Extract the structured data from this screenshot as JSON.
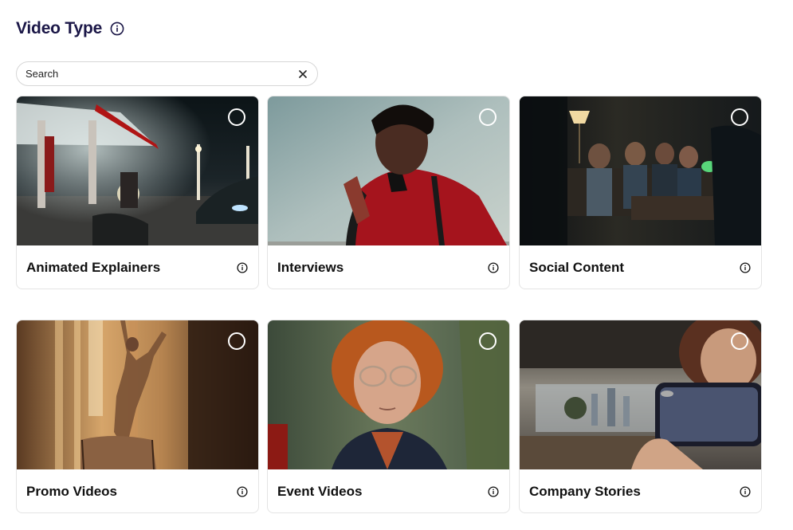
{
  "header": {
    "title": "Video Type",
    "info_icon": "info-icon"
  },
  "search": {
    "placeholder": "Search",
    "value": "",
    "clear_icon": "close-icon"
  },
  "cards": [
    {
      "label": "Animated Explainers",
      "selected": false,
      "image": "gas-station-night-motorcycle"
    },
    {
      "label": "Interviews",
      "selected": false,
      "image": "man-red-tracksuit-dancing"
    },
    {
      "label": "Social Content",
      "selected": false,
      "image": "friends-gaming-on-couch"
    },
    {
      "label": "Promo Videos",
      "selected": false,
      "image": "woman-stretching-by-window"
    },
    {
      "label": "Event Videos",
      "selected": false,
      "image": "curly-haired-man-glasses"
    },
    {
      "label": "Company Stories",
      "selected": false,
      "image": "woman-filming-with-phone"
    }
  ],
  "colors": {
    "title": "#1b1747",
    "border": "#e4e4e4",
    "radio": "#ffffff"
  }
}
